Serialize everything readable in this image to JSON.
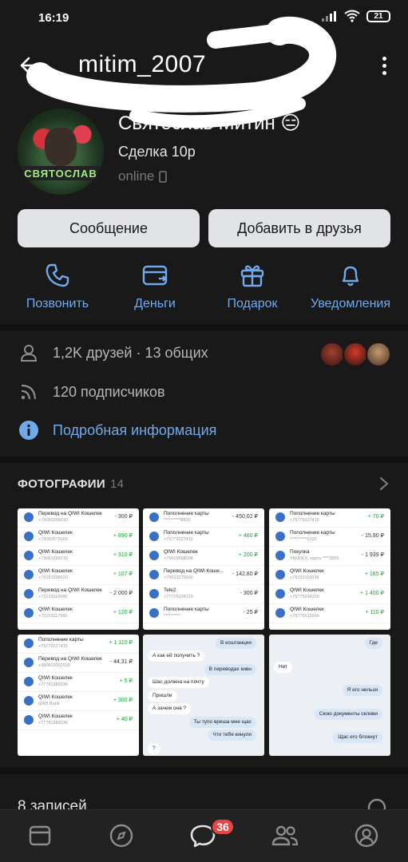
{
  "status_bar": {
    "time": "16:19",
    "battery": "21"
  },
  "header": {
    "title": "mitim_2007"
  },
  "profile": {
    "name": "Святослав Митин 😑",
    "status": "Сделка 10р",
    "online": "online",
    "avatar_caption": "СВЯТОСЛАВ"
  },
  "buttons": {
    "message": "Сообщение",
    "add_friend": "Добавить в друзья"
  },
  "actions": [
    {
      "label": "Позвонить",
      "icon": "phone-icon"
    },
    {
      "label": "Деньги",
      "icon": "money-icon"
    },
    {
      "label": "Подарок",
      "icon": "gift-icon"
    },
    {
      "label": "Уведомления",
      "icon": "bell-icon"
    }
  ],
  "info": {
    "friends": "1,2K друзей · 13 общих",
    "followers": "120 подписчиков",
    "details": "Подробная информация"
  },
  "photos": {
    "title": "ФОТОГРАФИИ",
    "count": "14",
    "p1": [
      {
        "t": "Перевод на QIWI Кошелек",
        "s": "+79050256010",
        "a": "- 300 ₽",
        "pos": false
      },
      {
        "t": "QIWI Кошелек",
        "s": "+79050575000",
        "a": "+ 890 ₽",
        "pos": true
      },
      {
        "t": "QIWI Кошелек",
        "s": "+79081569216",
        "a": "+ 310 ₽",
        "pos": true
      },
      {
        "t": "QIWI Кошелек",
        "s": "+79181598020",
        "a": "+ 107 ₽",
        "pos": true
      },
      {
        "t": "Перевод на QIWI Кошелек",
        "s": "+79133116086",
        "a": "- 2 000 ₽",
        "pos": false
      },
      {
        "t": "QIWI Кошелек",
        "s": "+79153117960",
        "a": "+ 120 ₽",
        "pos": true
      }
    ],
    "p2": [
      {
        "t": "Пополнение карты",
        "s": "**********8830",
        "a": "- 450,02 ₽",
        "pos": false
      },
      {
        "t": "Пополнение карты",
        "s": "+79779227415",
        "a": "+ 460 ₽",
        "pos": true
      },
      {
        "t": "QIWI Кошелек",
        "s": "+79619568008",
        "a": "+ 200 ₽",
        "pos": true
      },
      {
        "t": "Перевод на QIWI Коше...",
        "s": "+79623279000",
        "a": "- 142,80 ₽",
        "pos": false
      },
      {
        "t": "Tele2",
        "s": "+77715334319",
        "a": "- 300 ₽",
        "pos": false
      },
      {
        "t": "Пополнение карты",
        "s": "**********",
        "a": "- 25 ₽",
        "pos": false
      }
    ],
    "p3": [
      {
        "t": "Пополнение карты",
        "s": "+79779227415",
        "a": "+ 70 ₽",
        "pos": true
      },
      {
        "t": "Пополнение карты",
        "s": "**********6332",
        "a": "- 15,90 ₽",
        "pos": false
      },
      {
        "t": "Покупка",
        "s": "YANDEX, карта ****3655",
        "a": "- 1 939 ₽",
        "pos": false
      },
      {
        "t": "QIWI Кошелек",
        "s": "+79153116036",
        "a": "+ 165 ₽",
        "pos": true
      },
      {
        "t": "QIWI Кошелек",
        "s": "+79775334319",
        "a": "+ 1 400 ₽",
        "pos": true
      },
      {
        "t": "QIWI Кошелек",
        "s": "+79779215566",
        "a": "+ 110 ₽",
        "pos": true
      }
    ],
    "p4": [
      {
        "t": "Пополнение карты",
        "s": "+79779227415",
        "a": "+ 1 110 ₽",
        "pos": true
      },
      {
        "t": "Перевод на QIWI Кошелек",
        "s": "+380603002030",
        "a": "- 44,31 ₽",
        "pos": false
      },
      {
        "t": "QIWI Кошелек",
        "s": "+77781989336",
        "a": "+ 5 ₽",
        "pos": true
      },
      {
        "t": "QIWI Кошелек",
        "s": "QIWI Bank",
        "a": "+ 300 ₽",
        "pos": true
      },
      {
        "t": "QIWI Кошелек",
        "s": "+77781989336",
        "a": "+ 40 ₽",
        "pos": true
      }
    ],
    "p5": [
      {
        "t": "В коштанции",
        "r": true
      },
      {
        "t": "А как ей получить ?",
        "r": false
      },
      {
        "t": "В переводах кивн",
        "r": true
      },
      {
        "t": "Шас должна на почту",
        "r": false
      },
      {
        "t": "Пришли",
        "r": false
      },
      {
        "t": "А зачем она ?",
        "r": false
      },
      {
        "t": "Ты тупо вреша мне щас",
        "r": true
      },
      {
        "t": "Что тебя кинули",
        "r": true
      },
      {
        "t": "?",
        "r": false
      }
    ],
    "p6": [
      {
        "t": "Где",
        "r": true
      },
      {
        "t": "Нет",
        "r": false
      },
      {
        "t": "Я его нельзя",
        "r": true
      },
      {
        "t": "Скою документы скливи",
        "r": true
      },
      {
        "t": "Щас его блокнут",
        "r": true
      }
    ]
  },
  "records": "8 записей",
  "nav": {
    "badge": "36"
  }
}
